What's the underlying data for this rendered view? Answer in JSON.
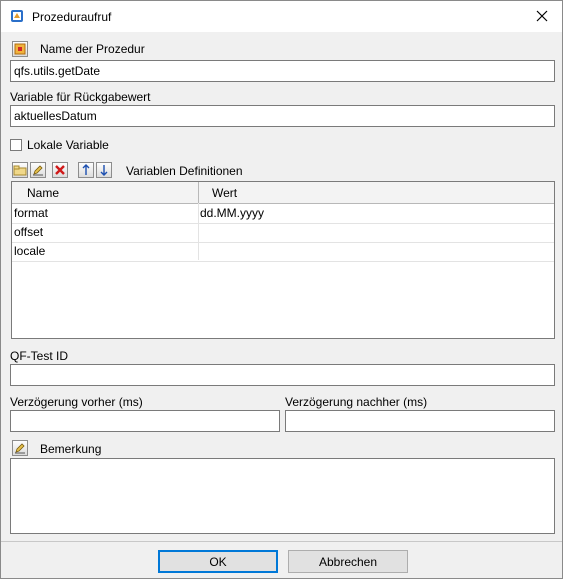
{
  "window": {
    "title": "Prozeduraufruf"
  },
  "procedure": {
    "label": "Name der Prozedur",
    "value": "qfs.utils.getDate"
  },
  "return_variable": {
    "label": "Variable für Rückgabewert",
    "value": "aktuellesDatum"
  },
  "local_variable": {
    "label": "Lokale Variable",
    "checked": false
  },
  "variables": {
    "label": "Variablen Definitionen",
    "columns": [
      "Name",
      "Wert"
    ],
    "rows": [
      {
        "name": "format",
        "value": "dd.MM.yyyy"
      },
      {
        "name": "offset",
        "value": ""
      },
      {
        "name": "locale",
        "value": ""
      }
    ]
  },
  "qftest_id": {
    "label": "QF-Test ID",
    "value": ""
  },
  "delay_before": {
    "label": "Verzögerung vorher (ms)",
    "value": ""
  },
  "delay_after": {
    "label": "Verzögerung nachher (ms)",
    "value": ""
  },
  "comment": {
    "label": "Bemerkung",
    "value": ""
  },
  "buttons": {
    "ok": "OK",
    "cancel": "Abbrechen"
  },
  "icons": {
    "title": "app-icon",
    "close": "close-icon",
    "procedure": "procedure-select-icon",
    "add": "add-row-icon",
    "edit": "edit-row-icon",
    "delete": "delete-row-icon",
    "up": "move-up-icon",
    "down": "move-down-icon",
    "comment": "edit-comment-icon"
  }
}
